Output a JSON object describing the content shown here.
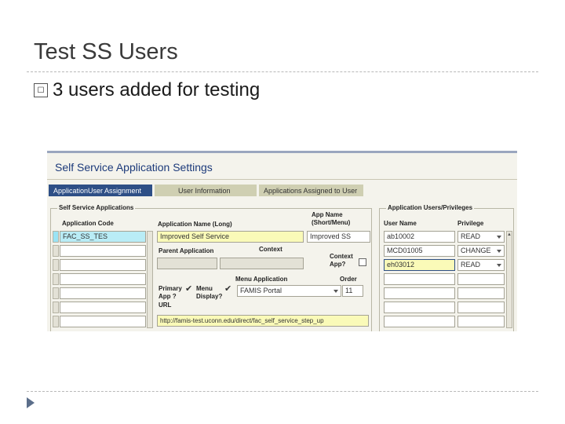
{
  "slide": {
    "title": "Test SS Users",
    "bullet_marker": "☐",
    "bullet_text": "3 users added for testing"
  },
  "app": {
    "window_title": "Self Service Application Settings",
    "tabs": [
      "ApplicationUser Assignment",
      "User Information",
      "Applications Assigned to User"
    ],
    "ss_apps": {
      "legend": "Self Service Applications",
      "col_app_code": "Application Code",
      "col_app_name_long": "Application Name (Long)",
      "col_app_name_short": "App Name (Short/Menu)",
      "app_code_value": "FAC_SS_TES",
      "app_name_long_value": "Improved Self Service",
      "app_name_short_value": "Improved SS",
      "parent_app_label": "Parent Application",
      "context_label": "Context",
      "context_app_label": "Context App?",
      "primary_app_label": "Primary App ?",
      "menu_display_label": "Menu Display?",
      "menu_app_label": "Menu Application",
      "menu_app_value": "FAMIS Portal",
      "order_label": "Order",
      "order_value": "11",
      "url_label": "URL",
      "url_value": "http://famis-test.uconn.edu/direct/fac_self_service_step_up"
    },
    "users": {
      "legend": "Application Users/Privileges",
      "col_user": "User Name",
      "col_priv": "Privilege",
      "rows": [
        {
          "user": "ab10002",
          "priv": "READ"
        },
        {
          "user": "MCD01005",
          "priv": "CHANGE"
        },
        {
          "user": "eh03012",
          "priv": "READ"
        }
      ]
    },
    "colors": {
      "tab_active": "#2e4f86",
      "title_blue": "#1c3a7a",
      "required_yellow": "#fafab8",
      "current_cyan": "#b9ecf6"
    }
  }
}
